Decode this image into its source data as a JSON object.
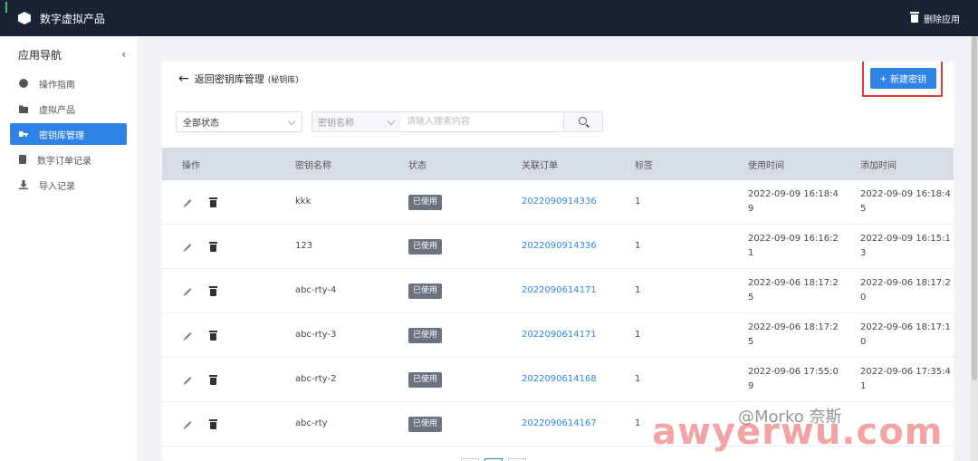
{
  "app": {
    "title": "数字虚拟产品",
    "delete_app_label": "删除应用"
  },
  "sidebar": {
    "heading": "应用导航",
    "collapse_glyph": "‹",
    "items": [
      {
        "label": "操作指南",
        "icon": "compass-icon",
        "active": false
      },
      {
        "label": "虚拟产品",
        "icon": "folder-icon",
        "active": false
      },
      {
        "label": "密钥库管理",
        "icon": "key-icon",
        "active": true
      },
      {
        "label": "数字订单记录",
        "icon": "clipboard-icon",
        "active": false
      },
      {
        "label": "导入记录",
        "icon": "download-icon",
        "active": false
      }
    ]
  },
  "page": {
    "back_label": "返回密钥库管理",
    "back_sub": "(秘钥库)",
    "new_key_label": "新建密钥"
  },
  "filters": {
    "status_value": "全部状态",
    "field_value": "密钥名称",
    "search_placeholder": "请输入搜索内容"
  },
  "table": {
    "columns": [
      "操作",
      "密钥名称",
      "状态",
      "关联订单",
      "标签",
      "使用时间",
      "添加时间"
    ],
    "rows": [
      {
        "name": "kkk",
        "status": "已使用",
        "order": "2022090914336",
        "tag": "1",
        "used_1": "2022-09-09 16:18:4",
        "used_2": "9",
        "added_1": "2022-09-09 16:18:4",
        "added_2": "5"
      },
      {
        "name": "123",
        "status": "已使用",
        "order": "2022090914336",
        "tag": "1",
        "used_1": "2022-09-09 16:16:2",
        "used_2": "1",
        "added_1": "2022-09-09 16:15:1",
        "added_2": "3"
      },
      {
        "name": "abc-rty-4",
        "status": "已使用",
        "order": "2022090614171",
        "tag": "1",
        "used_1": "2022-09-06 18:17:2",
        "used_2": "5",
        "added_1": "2022-09-06 18:17:2",
        "added_2": "0"
      },
      {
        "name": "abc-rty-3",
        "status": "已使用",
        "order": "2022090614171",
        "tag": "1",
        "used_1": "2022-09-06 18:17:2",
        "used_2": "5",
        "added_1": "2022-09-06 18:17:1",
        "added_2": "0"
      },
      {
        "name": "abc-rty-2",
        "status": "已使用",
        "order": "2022090614168",
        "tag": "1",
        "used_1": "2022-09-06 17:55:0",
        "used_2": "9",
        "added_1": "2022-09-06 17:35:4",
        "added_2": "1"
      },
      {
        "name": "abc-rty",
        "status": "已使用",
        "order": "2022090614167",
        "tag": "1",
        "used_1": "",
        "used_2": "",
        "added_1": "",
        "added_2": ""
      }
    ]
  },
  "watermark": {
    "main": "awyerwu.com",
    "sub": "@Morko 奈斯"
  }
}
